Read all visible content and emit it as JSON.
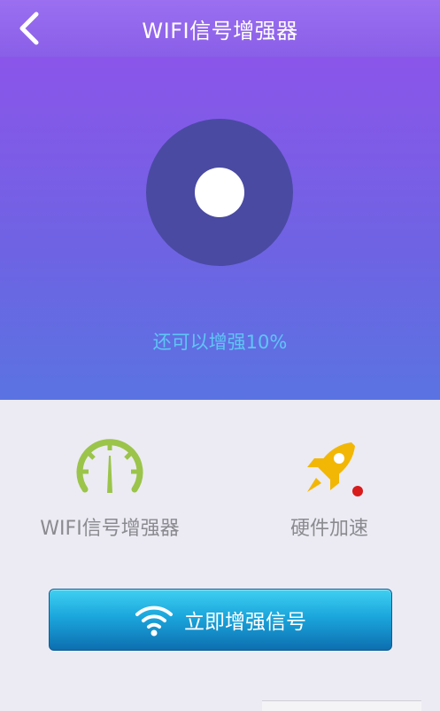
{
  "header": {
    "title": "WIFI信号增强器",
    "back_icon": "chevron-left-icon"
  },
  "hero": {
    "boost_text": "还可以增强10%",
    "colors": {
      "dial": "#4a4aa3",
      "dot": "#ffffff",
      "text": "#5ec6f4"
    }
  },
  "features": [
    {
      "label": "WIFI信号增强器",
      "icon": "speedometer-icon",
      "color": "#9bc44a"
    },
    {
      "label": "硬件加速",
      "icon": "rocket-icon",
      "color": "#f2b705",
      "badge": "red-dot"
    }
  ],
  "cta": {
    "label": "立即增强信号",
    "icon": "wifi-icon"
  }
}
